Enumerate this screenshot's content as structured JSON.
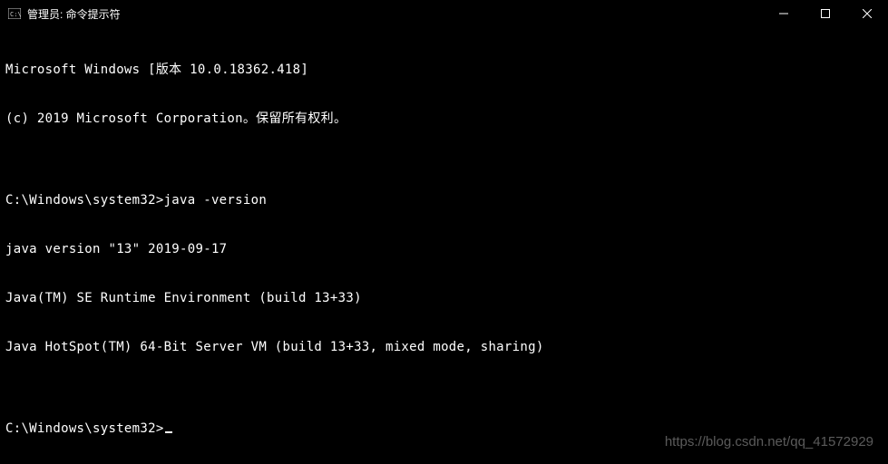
{
  "titlebar": {
    "title": "管理员: 命令提示符"
  },
  "terminal": {
    "lines": [
      "Microsoft Windows [版本 10.0.18362.418]",
      "(c) 2019 Microsoft Corporation。保留所有权利。",
      "",
      "C:\\Windows\\system32>java -version",
      "java version \"13\" 2019-09-17",
      "Java(TM) SE Runtime Environment (build 13+33)",
      "Java HotSpot(TM) 64-Bit Server VM (build 13+33, mixed mode, sharing)",
      "",
      "C:\\Windows\\system32>"
    ],
    "prompt": "C:\\Windows\\system32>",
    "command": "java -version"
  },
  "watermark": "https://blog.csdn.net/qq_41572929"
}
